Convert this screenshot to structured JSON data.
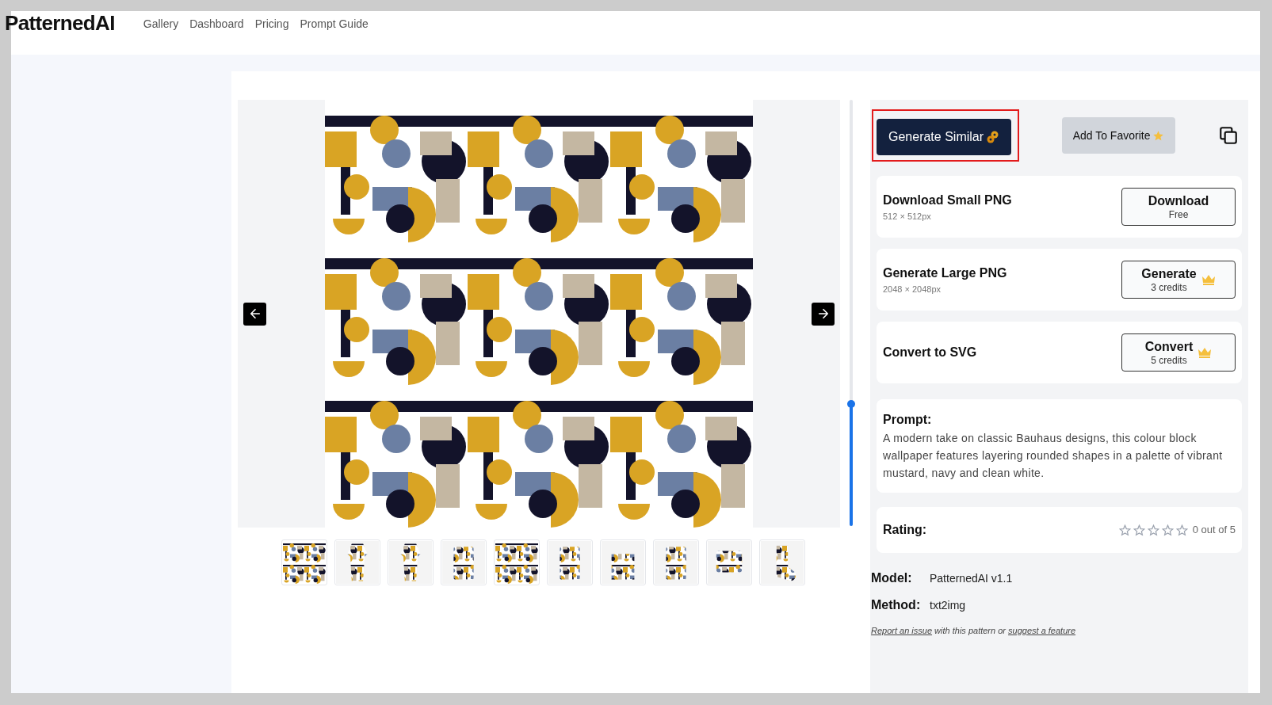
{
  "header": {
    "logo": "PatternedAI",
    "nav": [
      {
        "label": "Gallery"
      },
      {
        "label": "Dashboard"
      },
      {
        "label": "Pricing"
      },
      {
        "label": "Prompt Guide"
      }
    ]
  },
  "actions": {
    "generate_similar": "Generate Similar",
    "add_favorite": "Add To Favorite"
  },
  "options": [
    {
      "title": "Download Small PNG",
      "subtitle": "512 × 512px",
      "button": "Download",
      "button_sub": "Free",
      "premium": false
    },
    {
      "title": "Generate Large PNG",
      "subtitle": "2048 × 2048px",
      "button": "Generate",
      "button_sub": "3 credits",
      "premium": true
    },
    {
      "title": "Convert to SVG",
      "button": "Convert",
      "button_sub": "5 credits",
      "premium": true
    }
  ],
  "prompt": {
    "label": "Prompt:",
    "text": "A modern take on classic Bauhaus designs, this colour block wallpaper features layering rounded shapes in a palette of vibrant mustard, navy and clean white."
  },
  "rating": {
    "label": "Rating:",
    "stars": 0,
    "reading": "0 out of 5"
  },
  "meta": [
    {
      "label": "Model:",
      "value": "PatternedAI v1.1"
    },
    {
      "label": "Method:",
      "value": "txt2img"
    }
  ],
  "report": {
    "link1": "Report an issue",
    "middle": "with this pattern or",
    "link2": "suggest a feature"
  }
}
